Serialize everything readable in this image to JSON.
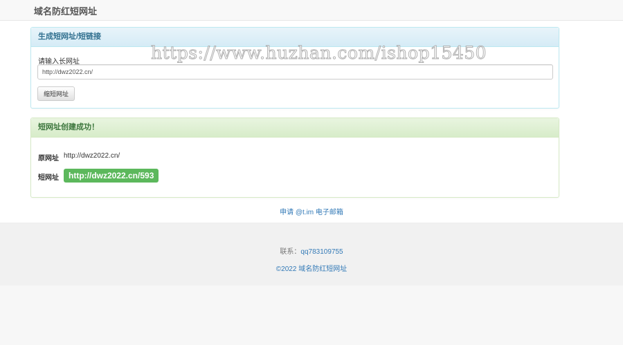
{
  "navbar": {
    "brand": "域名防红短网址"
  },
  "generate_panel": {
    "title": "生成短网址/短链接",
    "input_label": "请输入长网址",
    "input_value": "http://dwz2022.cn/",
    "submit_label": "缩短网址"
  },
  "result_panel": {
    "title": "短网址创建成功！",
    "original_label": "原网址",
    "original_value": "http://dwz2022.cn/",
    "short_label": "短网址",
    "short_value": "http://dwz2022.cn/593"
  },
  "watermark": "https://www.huzhan.com/ishop15450",
  "apply_link": "申请 @t.im 电子邮箱",
  "footer": {
    "contact_label": "联系：",
    "contact_value": "qq783109755",
    "copyright": "©2022 域名防红短网址"
  },
  "colors": {
    "info_heading": "#d9edf7",
    "success_heading": "#dff0d8",
    "badge_green": "#5cb85c",
    "link_blue": "#337ab7"
  }
}
